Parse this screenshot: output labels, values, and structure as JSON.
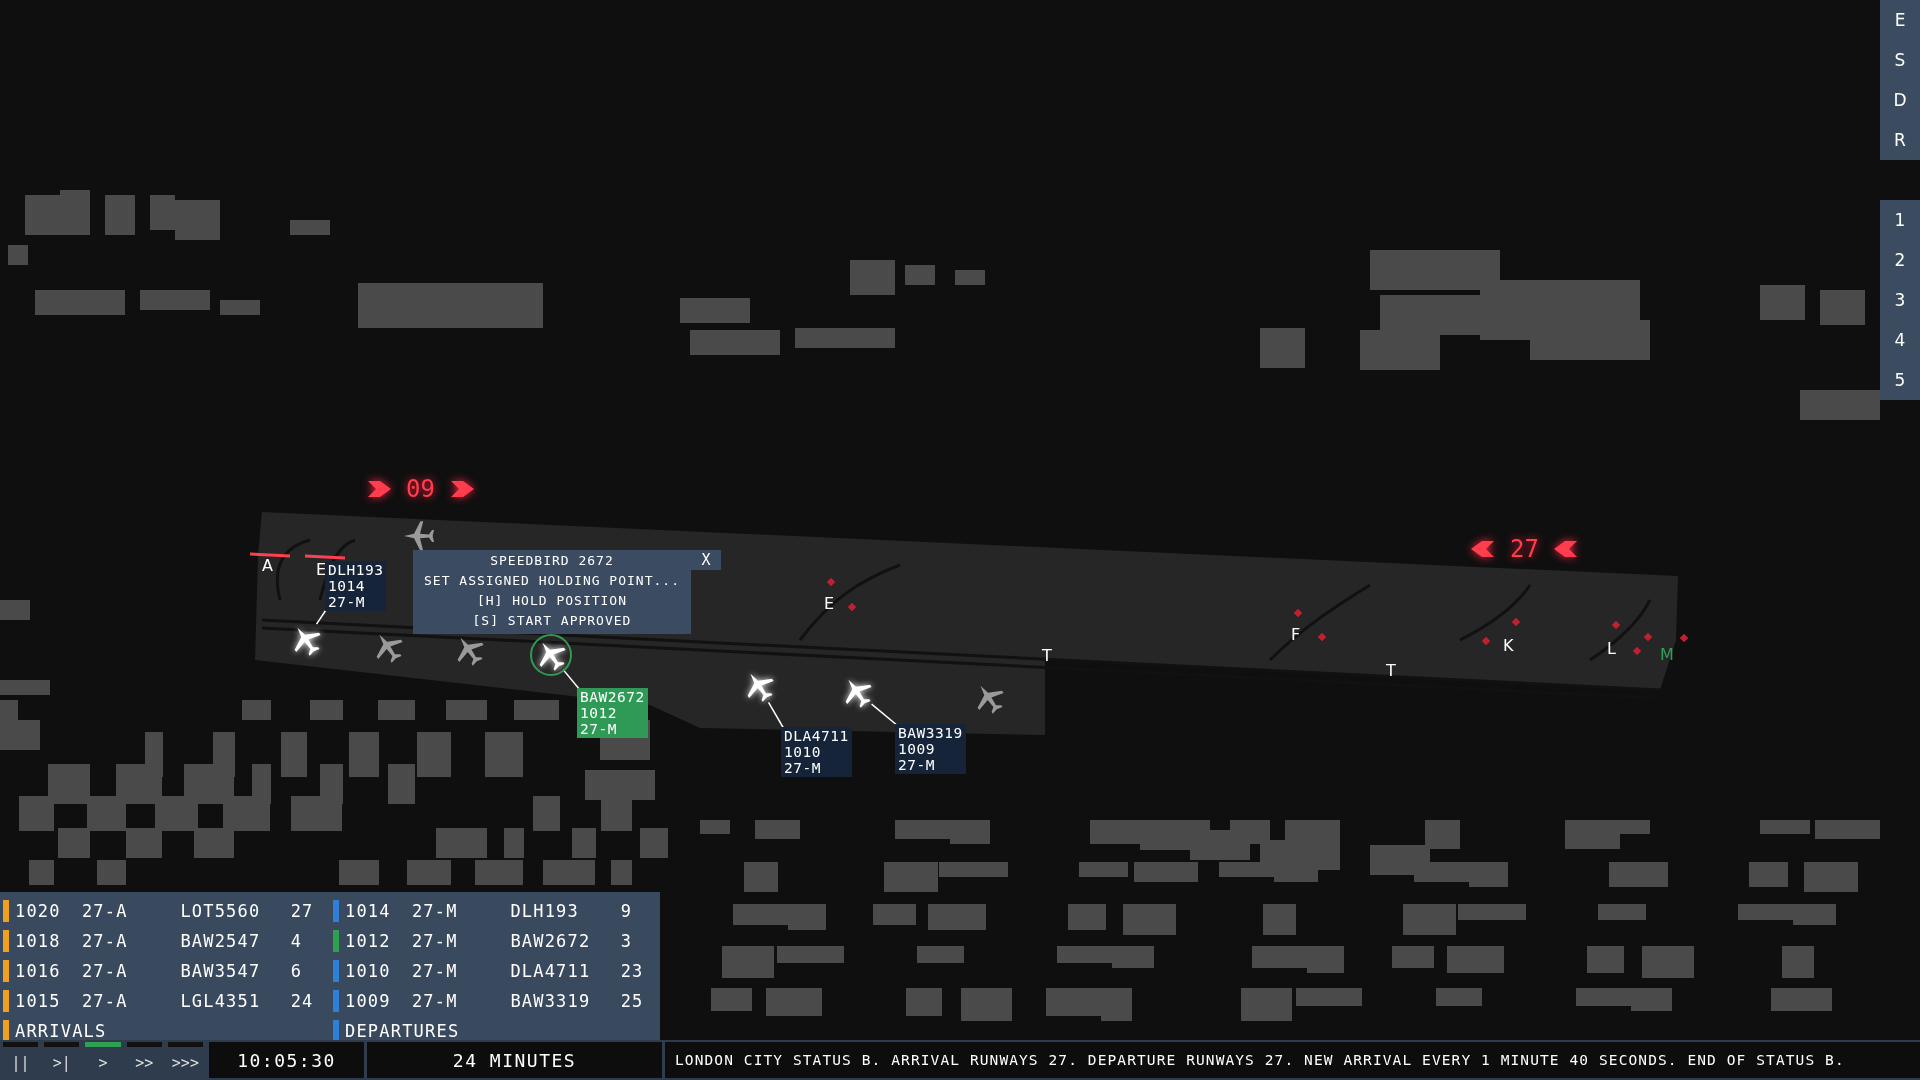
{
  "sidebar_groups": [
    {
      "items": [
        "E",
        "S",
        "D",
        "R"
      ]
    },
    {
      "items": [
        "1",
        "2",
        "3",
        "4",
        "5"
      ]
    }
  ],
  "runways": [
    {
      "label": "09",
      "kind": "right"
    },
    {
      "label": "27",
      "kind": "left"
    }
  ],
  "taxiways": [
    {
      "label": "A",
      "color": "#ffffff"
    },
    {
      "label": "E",
      "color": "#ffffff"
    },
    {
      "label": "E",
      "color": "#ffffff"
    },
    {
      "label": "T",
      "color": "#ffffff"
    },
    {
      "label": "F",
      "color": "#ffffff"
    },
    {
      "label": "T",
      "color": "#ffffff"
    },
    {
      "label": "K",
      "color": "#ffffff"
    },
    {
      "label": "L",
      "color": "#ffffff"
    },
    {
      "label": "M",
      "color": "#2fa05a"
    }
  ],
  "aircraft": [
    {
      "kind": "active",
      "selected": false,
      "tag": [
        "DLH193",
        "1014",
        "27-M"
      ]
    },
    {
      "kind": "active",
      "selected": true,
      "tag": [
        "BAW2672",
        "1012",
        "27-M"
      ]
    },
    {
      "kind": "active",
      "selected": false,
      "tag": [
        "DLA4711",
        "1010",
        "27-M"
      ]
    },
    {
      "kind": "active",
      "selected": false,
      "tag": [
        "BAW3319",
        "1009",
        "27-M"
      ]
    },
    {
      "kind": "parked"
    },
    {
      "kind": "parked"
    },
    {
      "kind": "parked"
    },
    {
      "kind": "parked"
    }
  ],
  "command_menu": {
    "title": "SPEEDBIRD 2672",
    "close": "X",
    "items": [
      "SET ASSIGNED HOLDING POINT...",
      "[H] HOLD POSITION",
      "[S] START APPROVED"
    ]
  },
  "strip_lists": [
    {
      "kind": "arrivals",
      "title": "ARRIVALS",
      "rows": [
        {
          "cells": [
            "1020",
            "27-A",
            "LOT5560",
            "27"
          ],
          "selected": false
        },
        {
          "cells": [
            "1018",
            "27-A",
            "BAW2547",
            "4"
          ],
          "selected": false
        },
        {
          "cells": [
            "1016",
            "27-A",
            "BAW3547",
            "6"
          ],
          "selected": false
        },
        {
          "cells": [
            "1015",
            "27-A",
            "LGL4351",
            "24"
          ],
          "selected": false
        }
      ]
    },
    {
      "kind": "departures",
      "title": "DEPARTURES",
      "rows": [
        {
          "cells": [
            "1014",
            "27-M",
            "DLH193",
            "9"
          ],
          "selected": false
        },
        {
          "cells": [
            "1012",
            "27-M",
            "BAW2672",
            "3"
          ],
          "selected": true
        },
        {
          "cells": [
            "1010",
            "27-M",
            "DLA4711",
            "23"
          ],
          "selected": false
        },
        {
          "cells": [
            "1009",
            "27-M",
            "BAW3319",
            "25"
          ],
          "selected": false
        }
      ]
    }
  ],
  "speed_controls": [
    {
      "label": "||",
      "selected": false
    },
    {
      "label": ">|",
      "selected": false
    },
    {
      "label": ">",
      "selected": true
    },
    {
      "label": ">>",
      "selected": false
    },
    {
      "label": ">>>",
      "selected": false
    }
  ],
  "clock": "10:05:30",
  "elapsed": "24 MINUTES",
  "status_bar": "LONDON CITY STATUS B. ARRIVAL RUNWAYS 27. DEPARTURE RUNWAYS 27. NEW ARRIVAL EVERY 1 MINUTE 40 SECONDS. END OF STATUS B."
}
